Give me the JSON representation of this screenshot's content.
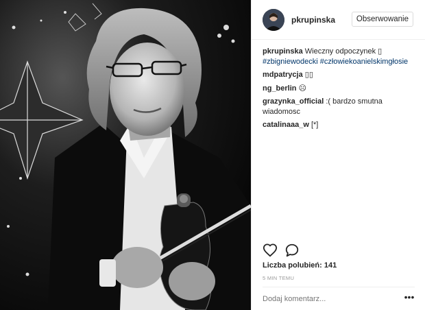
{
  "post": {
    "username": "pkrupinska",
    "follow_label": "Obserwowanie",
    "caption": {
      "author": "pkrupinska",
      "text": "Wieczny odpoczynek",
      "emoji_box": "▯",
      "hashtags": [
        "#zbigniewodecki",
        "#człowiekoanielskimgłosie"
      ]
    },
    "comments": [
      {
        "author": "mdpatrycja",
        "text": "▯▯"
      },
      {
        "author": "ng_berlin",
        "text": "☹"
      },
      {
        "author": "grazynka_official",
        "text": ":( bardzo smutna wiadomosc"
      },
      {
        "author": "catalinaaa_w",
        "text": "[*]"
      }
    ],
    "likes_label": "Liczba polubień: 141",
    "timestamp": "5 MIN TEMU",
    "comment_placeholder": "Dodaj komentarz...",
    "more_icon": "•••"
  },
  "icons": {
    "like": "heart-icon",
    "comment": "comment-icon",
    "more": "more-options-icon"
  }
}
